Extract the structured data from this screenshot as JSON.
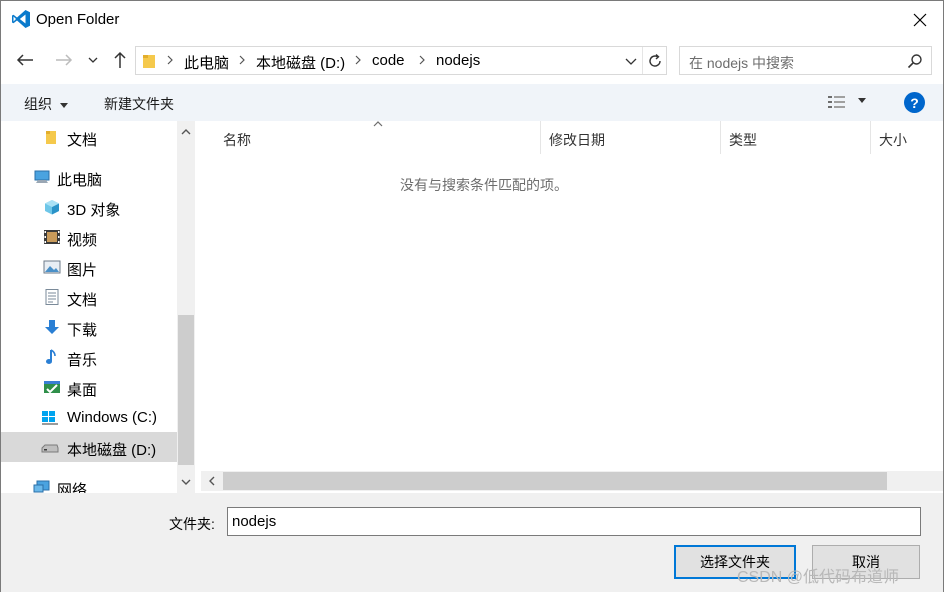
{
  "window": {
    "title": "Open Folder"
  },
  "breadcrumb": [
    "此电脑",
    "本地磁盘 (D:)",
    "code",
    "nodejs"
  ],
  "search": {
    "placeholder": "在 nodejs 中搜索"
  },
  "toolbar": {
    "organize_label": "组织",
    "new_folder_label": "新建文件夹",
    "help_label": "?"
  },
  "nav": {
    "items": [
      {
        "label": "文档",
        "icon": "folder-icon"
      },
      {
        "label": "此电脑",
        "icon": "computer-icon"
      },
      {
        "label": "3D 对象",
        "icon": "cube-icon"
      },
      {
        "label": "视频",
        "icon": "video-icon"
      },
      {
        "label": "图片",
        "icon": "picture-icon"
      },
      {
        "label": "文档",
        "icon": "document-icon"
      },
      {
        "label": "下载",
        "icon": "download-icon"
      },
      {
        "label": "音乐",
        "icon": "music-icon"
      },
      {
        "label": "桌面",
        "icon": "desktop-icon"
      },
      {
        "label": "Windows (C:)",
        "icon": "windows-drive-icon"
      },
      {
        "label": "本地磁盘 (D:)",
        "icon": "drive-icon",
        "selected": true
      },
      {
        "label": "网络",
        "icon": "network-icon"
      }
    ]
  },
  "columns": [
    "名称",
    "修改日期",
    "类型",
    "大小"
  ],
  "content": {
    "empty_message": "没有与搜索条件匹配的项。"
  },
  "footer": {
    "folder_label": "文件夹:",
    "folder_value": "nodejs",
    "select_label": "选择文件夹",
    "cancel_label": "取消"
  },
  "watermark": "CSDN @低代码布道师",
  "colors": {
    "accent": "#0078d7",
    "help": "#0066cc",
    "selected_bg": "#d9d9d9"
  }
}
